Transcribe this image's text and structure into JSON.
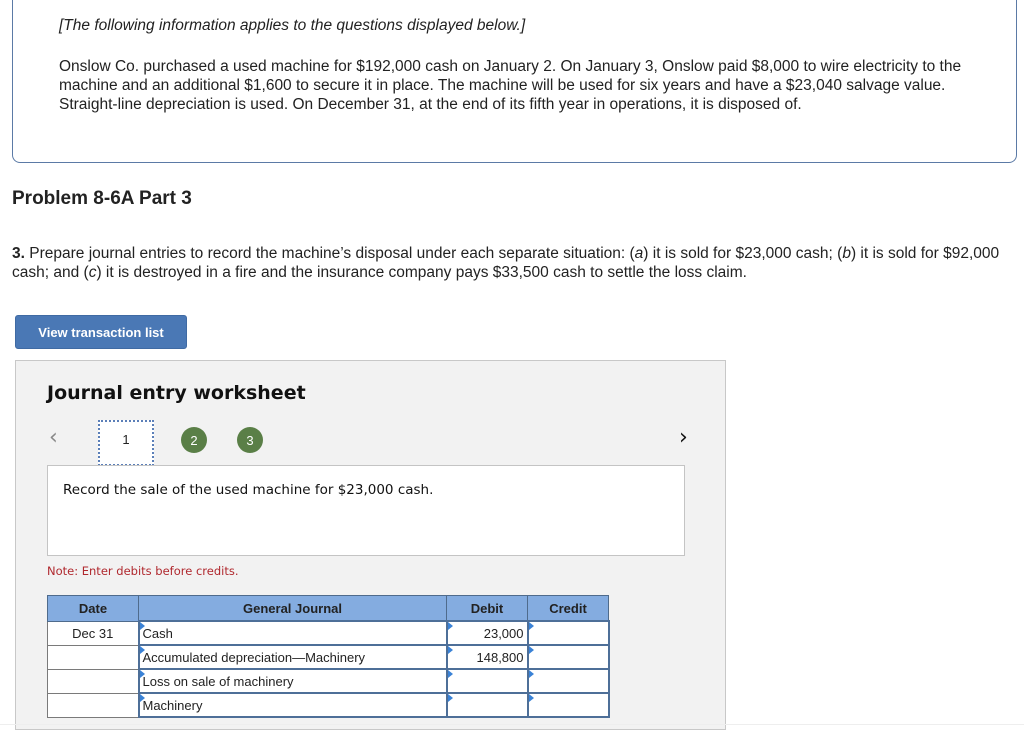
{
  "info": {
    "intro": "[The following information applies to the questions displayed below.]",
    "body": "Onslow Co. purchased a used machine for $192,000 cash on January 2. On January 3, Onslow paid $8,000 to wire electricity to the machine and an additional $1,600 to secure it in place. The machine will be used for six years and have a $23,040 salvage value. Straight-line depreciation is used. On December 31, at the end of its fifth year in operations, it is disposed of."
  },
  "problem": {
    "title": "Problem 8-6A Part 3",
    "question_number": "3.",
    "question_parts": [
      " Prepare journal entries to record the machine’s disposal under each separate situation: (",
      "a",
      ") it is sold for $23,000 cash; (",
      "b",
      ") it is sold for $92,000 cash; and (",
      "c",
      ") it is destroyed in a fire and the insurance company pays $33,500 cash to settle the loss claim."
    ]
  },
  "buttons": {
    "view_transaction_list": "View transaction list"
  },
  "worksheet": {
    "title": "Journal entry worksheet",
    "prev_icon": "‹",
    "next_icon": "›",
    "steps": [
      {
        "label": "1",
        "state": "current"
      },
      {
        "label": "2",
        "state": "completed"
      },
      {
        "label": "3",
        "state": "completed"
      }
    ],
    "step_color": "#5a7f47",
    "description": "Record the sale of the used machine for $23,000 cash.",
    "note": "Note: Enter debits before credits.",
    "table": {
      "headers": [
        "Date",
        "General Journal",
        "Debit",
        "Credit"
      ],
      "header_color": "#84ace0",
      "rows": [
        {
          "date": "Dec 31",
          "account": "Cash",
          "debit": "23,000",
          "credit": ""
        },
        {
          "date": "",
          "account": "Accumulated depreciation—Machinery",
          "debit": "148,800",
          "credit": ""
        },
        {
          "date": "",
          "account": "Loss on sale of machinery",
          "debit": "",
          "credit": ""
        },
        {
          "date": "",
          "account": "Machinery",
          "debit": "",
          "credit": ""
        }
      ]
    }
  }
}
